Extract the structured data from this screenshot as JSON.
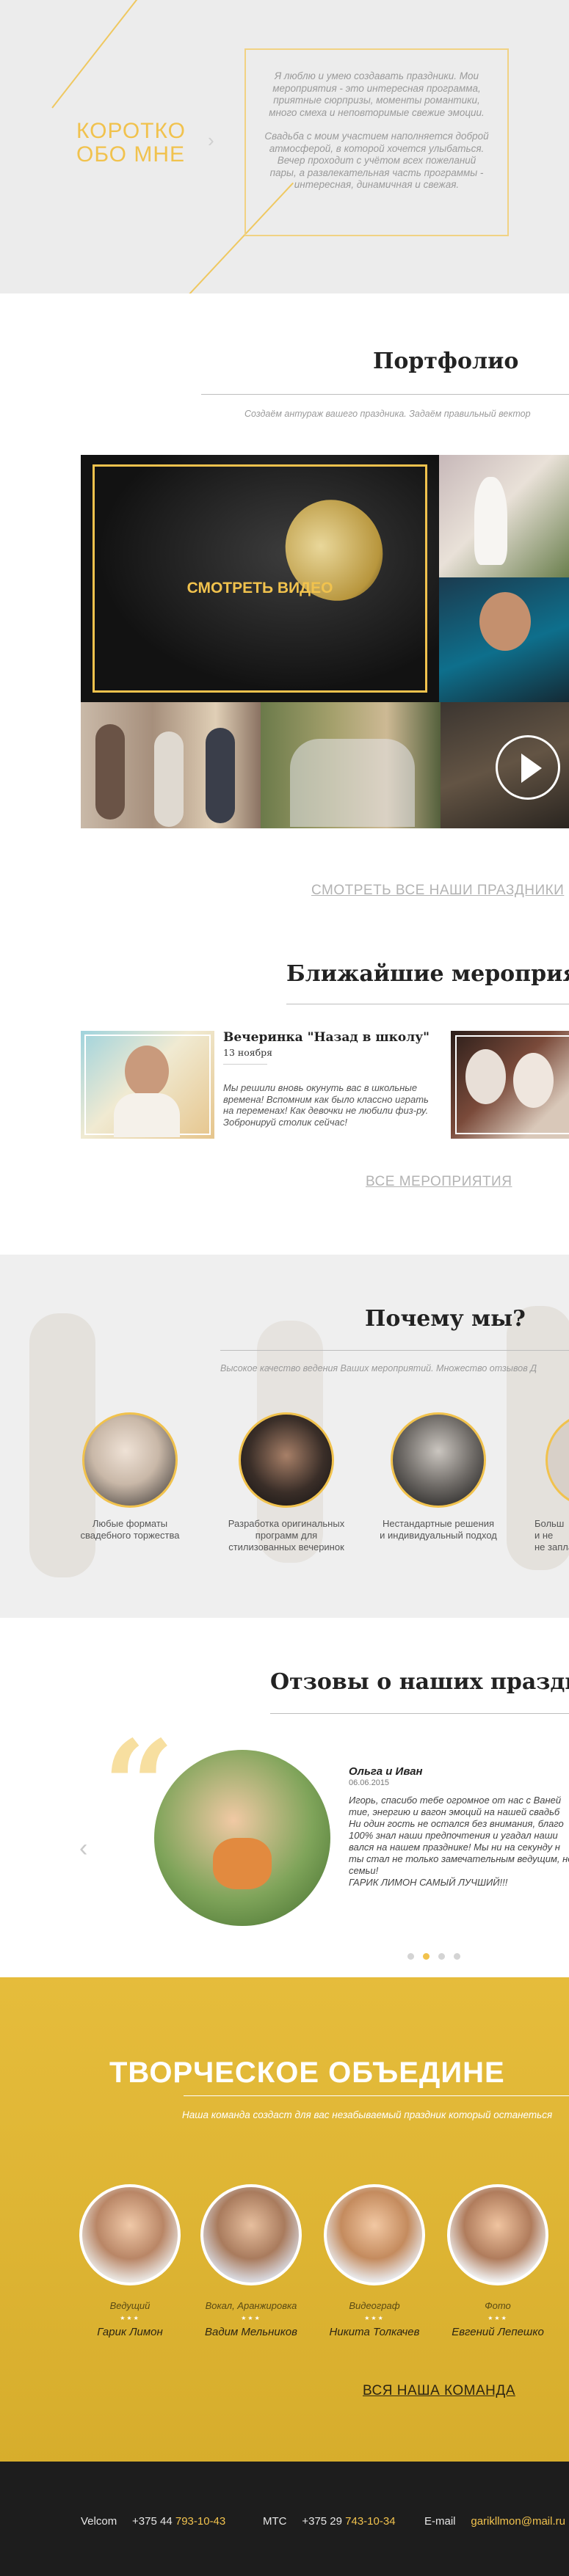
{
  "about": {
    "heading_line1": "Коротко",
    "heading_line2": "обо мне",
    "para1": "Я люблю и умею создавать праздники. Мои мероприятия - это интересная программа, приятные сюрпризы, моменты романтики, много смеха и неповторимые свежие эмоции.",
    "para2": "Свадьба с моим участием наполняется доброй атмосферой, в которой хочется улыбаться. Вечер проходит с учётом всех пожеланий пары, а развлекательная часть программы - интересная, динамичная и свежая.",
    "chevron_icon": "chevron-right-icon"
  },
  "portfolio": {
    "title": "Портфолио",
    "subtitle": "Создаём антураж вашего праздника. Задаём правильный вектор",
    "video_label": "Смотреть видео",
    "all_link": "Смотреть все наши праздники",
    "play_icon": "play-icon"
  },
  "events": {
    "title": "Ближайшие мероприяти",
    "items": [
      {
        "title": "Вечеринка \"Назад в школу\"",
        "date": "13 ноября",
        "text": "Мы решили вновь окунуть вас в школьные времена! Вспомним как было классно играть на переменах! Как девочки не любили физ-ру. Зобронируй столик сейчас!"
      }
    ],
    "all_link": "Все мероприятия"
  },
  "why": {
    "title": "Почему мы?",
    "subtitle": "Высокое качество ведения Ваших мероприятий. Множество отзывов Д",
    "items": [
      {
        "caption_line1": "Любые форматы",
        "caption_line2": "свадебного торжества"
      },
      {
        "caption_line1": "Разработка оригинальных",
        "caption_line2": "программ для",
        "caption_line3": "стилизованных вечеринок"
      },
      {
        "caption_line1": "Нестандартные решения",
        "caption_line2": "и индивидуальный подход"
      },
      {
        "caption_line1": "Больш",
        "caption_line2": "и не",
        "caption_line3": "не запла"
      }
    ]
  },
  "reviews": {
    "title": "Отзовы о наших праздни",
    "name": "Ольга и Иван",
    "date": "06.06.2015",
    "lines": [
      "Игорь, спасибо тебе огромное от нас с Ваней",
      "тие, энергию и вагон эмоций на нашей свадьб",
      "Ни один гость не остался без внимания, благо",
      "100% знал наши предпочтения и угадал наши",
      "вался на нашем празднике! Мы ни на секунду н",
      "ты стал не только замечательным ведущим, но",
      "семьи!",
      "ГАРИК ЛИМОН САМЫЙ ЛУЧШИЙ!!!"
    ],
    "prev_icon": "chevron-left-icon",
    "quote_icon": "quote-icon",
    "dots": 4,
    "active_dot": 1
  },
  "team": {
    "title": "Творческое объедине",
    "subtitle": "Наша команда создаст для вас незабываемый праздник который останеться",
    "members": [
      {
        "role": "Ведущий",
        "name": "Гарик Лимон"
      },
      {
        "role": "Вокал, Аранжировка",
        "name": "Вадим Мельников"
      },
      {
        "role": "Видеограф",
        "name": "Никита Толкачев"
      },
      {
        "role": "Фото",
        "name": "Евгений Лепешко"
      }
    ],
    "stars": "★★★",
    "all_link": "Вся наша команда"
  },
  "footer": {
    "velcom_label": "Velcom",
    "velcom_code": "+375 44",
    "velcom_number": "793-10-43",
    "mts_label": "МТС",
    "mts_code": "+375 29",
    "mts_number": "743-10-34",
    "email_label": "E-mail",
    "email_value": "garikllmon@mail.ru"
  },
  "colors": {
    "accent": "#f1c24d",
    "team_bg": "#e4b82f",
    "footer_bg": "#1d1d1d"
  }
}
